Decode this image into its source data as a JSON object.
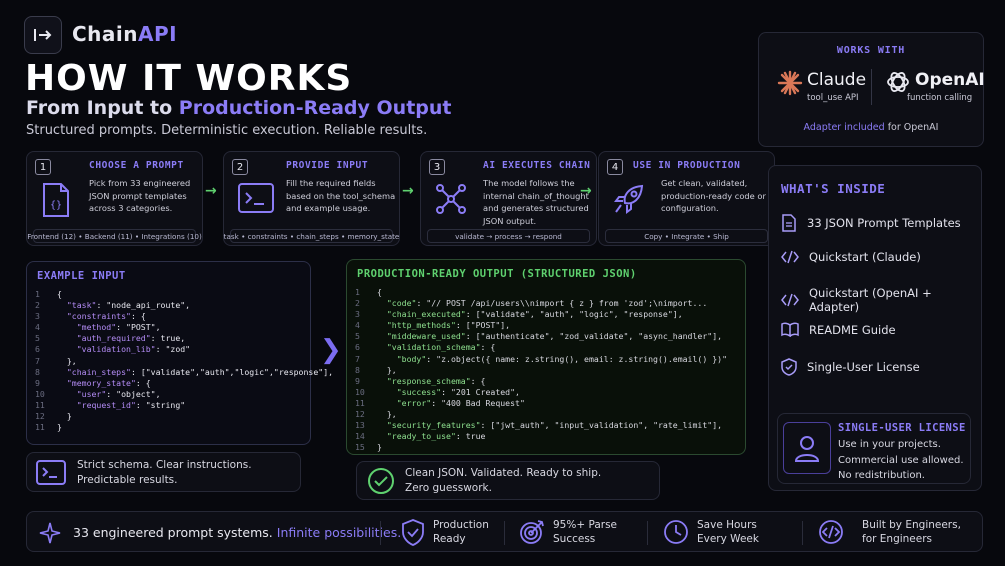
{
  "brand": {
    "prefix": "Chain",
    "accent": "API"
  },
  "hero": {
    "headline": "HOW IT WORKS",
    "subhead_prefix": "From Input to ",
    "subhead_accent": "Production-Ready Output",
    "tagline": "Structured prompts. Deterministic execution. Reliable results."
  },
  "steps": [
    {
      "num": "1",
      "title": "CHOOSE A PROMPT",
      "desc": "Pick from 33 engineered JSON prompt templates across 3 categories.",
      "footer": "Frontend (12) • Backend (11) • Integrations (10)",
      "icon": "json-file-icon"
    },
    {
      "num": "2",
      "title": "PROVIDE INPUT",
      "desc": "Fill the required fields based on the tool_schema and example usage.",
      "footer": "task • constraints • chain_steps • memory_state",
      "icon": "terminal-icon"
    },
    {
      "num": "3",
      "title": "AI EXECUTES CHAIN",
      "desc": "The model follows the internal chain_of_thought and generates structured JSON output.",
      "footer": "validate → process → respond",
      "icon": "network-icon"
    },
    {
      "num": "4",
      "title": "USE IN PRODUCTION",
      "desc": "Get clean, validated, production-ready code or configuration.",
      "footer": "Copy • Integrate • Ship",
      "icon": "rocket-icon"
    }
  ],
  "example_input": {
    "title": "EXAMPLE INPUT",
    "lines": [
      {
        "n": "1",
        "text": "{"
      },
      {
        "n": "2",
        "text": "  \"task\": \"node_api_route\","
      },
      {
        "n": "3",
        "text": "  \"constraints\": {"
      },
      {
        "n": "4",
        "text": "    \"method\": \"POST\","
      },
      {
        "n": "5",
        "text": "    \"auth_required\": true,"
      },
      {
        "n": "6",
        "text": "    \"validation_lib\": \"zod\""
      },
      {
        "n": "7",
        "text": "  },"
      },
      {
        "n": "8",
        "text": "  \"chain_steps\": [\"validate\",\"auth\",\"logic\",\"response\"],"
      },
      {
        "n": "9",
        "text": "  \"memory_state\": {"
      },
      {
        "n": "10",
        "text": "    \"user\": \"object\","
      },
      {
        "n": "11",
        "text": "    \"request_id\": \"string\""
      },
      {
        "n": "12",
        "text": "  }"
      },
      {
        "n": "11",
        "text": "}"
      }
    ]
  },
  "output": {
    "title": "PRODUCTION-READY OUTPUT (STRUCTURED JSON)",
    "lines": [
      {
        "n": "1",
        "text": "{"
      },
      {
        "n": "2",
        "text": "  \"code\": \"// POST /api/users\\\\nimport { z } from 'zod';\\nimport..."
      },
      {
        "n": "3",
        "text": "  \"chain_executed\": [\"validate\", \"auth\", \"logic\", \"response\"],"
      },
      {
        "n": "4",
        "text": "  \"http_methods\": [\"POST\"],"
      },
      {
        "n": "5",
        "text": "  \"middeware_used\": [\"authenticate\", \"zod_validate\", \"async_handler\"],"
      },
      {
        "n": "6",
        "text": "  \"validation_schema\": {"
      },
      {
        "n": "7",
        "text": "    \"body\": \"z.object({ name: z.string(), email: z.string().email() })\""
      },
      {
        "n": "8",
        "text": "  },"
      },
      {
        "n": "9",
        "text": "  \"response_schema\": {"
      },
      {
        "n": "10",
        "text": "    \"success\": \"201 Created\","
      },
      {
        "n": "11",
        "text": "    \"error\": \"400 Bad Request\""
      },
      {
        "n": "12",
        "text": "  },"
      },
      {
        "n": "13",
        "text": "  \"security_features\": [\"jwt_auth\", \"input_validation\", \"rate_limit\"],"
      },
      {
        "n": "14",
        "text": "  \"ready_to_use\": true"
      },
      {
        "n": "15",
        "text": "}"
      }
    ]
  },
  "notes": {
    "input_line1": "Strict schema. Clear instructions.",
    "input_line2": "Predictable results.",
    "output_line1": "Clean JSON. Validated. Ready to ship.",
    "output_line2": "Zero guesswork."
  },
  "works_with": {
    "title": "WORKS WITH",
    "claude_name": "Claude",
    "claude_sub": "tool_use API",
    "openai_name": "OpenAI",
    "openai_sub": "function calling",
    "adapter_accent": "Adapter included",
    "adapter_rest": " for OpenAI"
  },
  "inside": {
    "title": "WHAT'S INSIDE",
    "items": [
      {
        "label": "33 JSON Prompt Templates",
        "icon": "document-icon"
      },
      {
        "label": "Quickstart (Claude)",
        "icon": "code-icon"
      },
      {
        "label": "Quickstart (OpenAI + Adapter)",
        "icon": "code-icon"
      },
      {
        "label": "README Guide",
        "icon": "book-icon"
      },
      {
        "label": "Single-User License",
        "icon": "shield-icon"
      }
    ]
  },
  "license": {
    "title": "SINGLE-USER LICENSE",
    "line1": "Use in your projects.",
    "line2": "Commercial use allowed.",
    "line3": "No redistribution."
  },
  "footer": {
    "main": "33 engineered prompt systems.",
    "accent": "Infinite possibilities.",
    "items": [
      {
        "line1": "Production",
        "line2": "Ready",
        "icon": "shield-check-icon"
      },
      {
        "line1": "95%+ Parse",
        "line2": "Success",
        "icon": "target-icon"
      },
      {
        "line1": "Save Hours",
        "line2": "Every Week",
        "icon": "clock-icon"
      },
      {
        "line1": "Built by Engineers,",
        "line2": "for Engineers",
        "icon": "code-circle-icon"
      }
    ]
  },
  "colors": {
    "accent": "#8b7cf6",
    "green": "#5fd16f",
    "claude": "#d97757",
    "bg": "#07080d"
  }
}
